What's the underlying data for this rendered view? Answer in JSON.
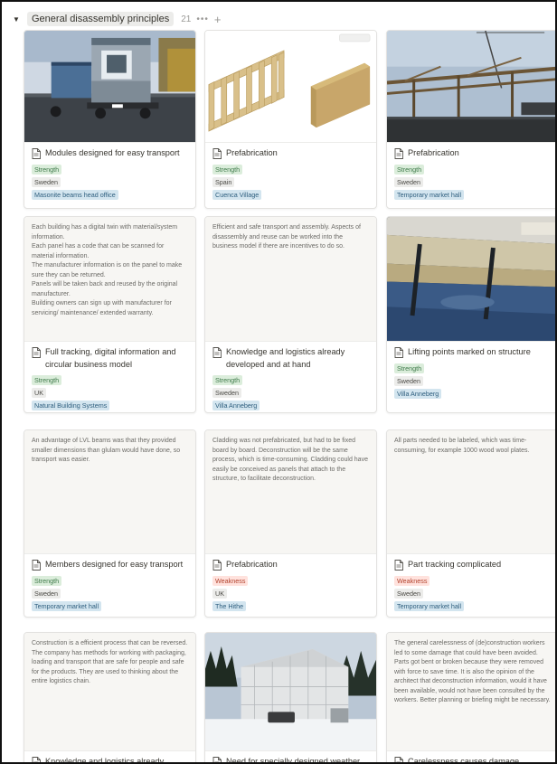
{
  "group": {
    "title": "General disassembly principles",
    "count": "21",
    "toggle_icon": "triangle-down-icon",
    "more_icon": "more-horizontal-icon",
    "add_icon": "plus-icon"
  },
  "colors": {
    "strength_tag": "#dbeddb",
    "weakness_tag": "#ffe2dd",
    "country_tag": "#ececea",
    "project_tag": "#d3e5ef"
  },
  "cards": [
    {
      "title": "Modules designed for easy transport",
      "tags": [
        "Strength",
        "Sweden",
        "Masonite beams head office"
      ],
      "cover": "photo of modular building unit on a truck",
      "text": ""
    },
    {
      "title": "Prefabrication",
      "tags": [
        "Strength",
        "Spain",
        "Cuenca Village"
      ],
      "cover": "illustration of timber frame and panel",
      "text": ""
    },
    {
      "title": "Prefabrication",
      "tags": [
        "Strength",
        "Sweden",
        "Temporary market hall"
      ],
      "cover": "photo of timber structure with crane",
      "text": ""
    },
    {
      "title": "Full tracking, digital information and circular business model",
      "tags": [
        "Strength",
        "UK",
        "Natural Building Systems"
      ],
      "cover": "",
      "text": "Each building has a digital twin with material/system information.\nEach panel has a code that can be scanned for material information.\nThe manufacturer information is on the panel to make sure they can be returned.\nPanels will be taken back and reused by the original manufacturer.\nBuilding owners can sign up with manufacturer for servicing/ maintenance/ extended warranty."
    },
    {
      "title": "Knowledge and logistics already developed and at hand",
      "tags": [
        "Strength",
        "Sweden",
        "Villa Anneberg"
      ],
      "cover": "",
      "text": "Efficient and safe transport and assembly. Aspects of disassembly and reuse can be worked into the business model if there are incentives to do so."
    },
    {
      "title": "Lifting points marked on structure",
      "tags": [
        "Strength",
        "Sweden",
        "Villa Anneberg"
      ],
      "cover": "photo of lifting point on timber element",
      "text": ""
    },
    {
      "title": "Members designed for easy transport",
      "tags": [
        "Strength",
        "Sweden",
        "Temporary market hall"
      ],
      "cover": "",
      "text": "An advantage of LVL beams was that they provided smaller dimensions than glulam would have done, so transport was easier."
    },
    {
      "title": "Prefabrication",
      "tags": [
        "Weakness",
        "UK",
        "The Hithe"
      ],
      "cover": "",
      "text": "Cladding was not prefabricated, but had to be fixed board by board. Deconstruction will be the same process, which is time-consuming. Cladding could have easily be conceived as panels that attach to the structure, to facilitate deconstruction."
    },
    {
      "title": "Part tracking complicated",
      "tags": [
        "Weakness",
        "Sweden",
        "Temporary market hall"
      ],
      "cover": "",
      "text": "All parts needed to be labeled, which was time-consuming, for example 1000 wood wool plates."
    },
    {
      "title": "Knowledge and logistics already",
      "tags": [],
      "cover": "",
      "text": "Construction is a efficient process that can be reversed. The company has methods for working with packaging, loading and transport that are safe for people and safe for the products. They are used to thinking about the entire logistics chain."
    },
    {
      "title": "Need for specially designed weather",
      "tags": [],
      "cover": "photo of building under weather protection in winter",
      "text": ""
    },
    {
      "title": "Carelessness causes damage",
      "tags": [],
      "cover": "",
      "text": "The general carelessness of (de)construction workers led to some damage that could have been avoided. Parts got bent or broken because they were removed with force to save time. It is also the opinion of the architect that deconstruction information, would it have been available, would not have been consulted by the workers. Better planning or briefing might be necessary."
    }
  ]
}
